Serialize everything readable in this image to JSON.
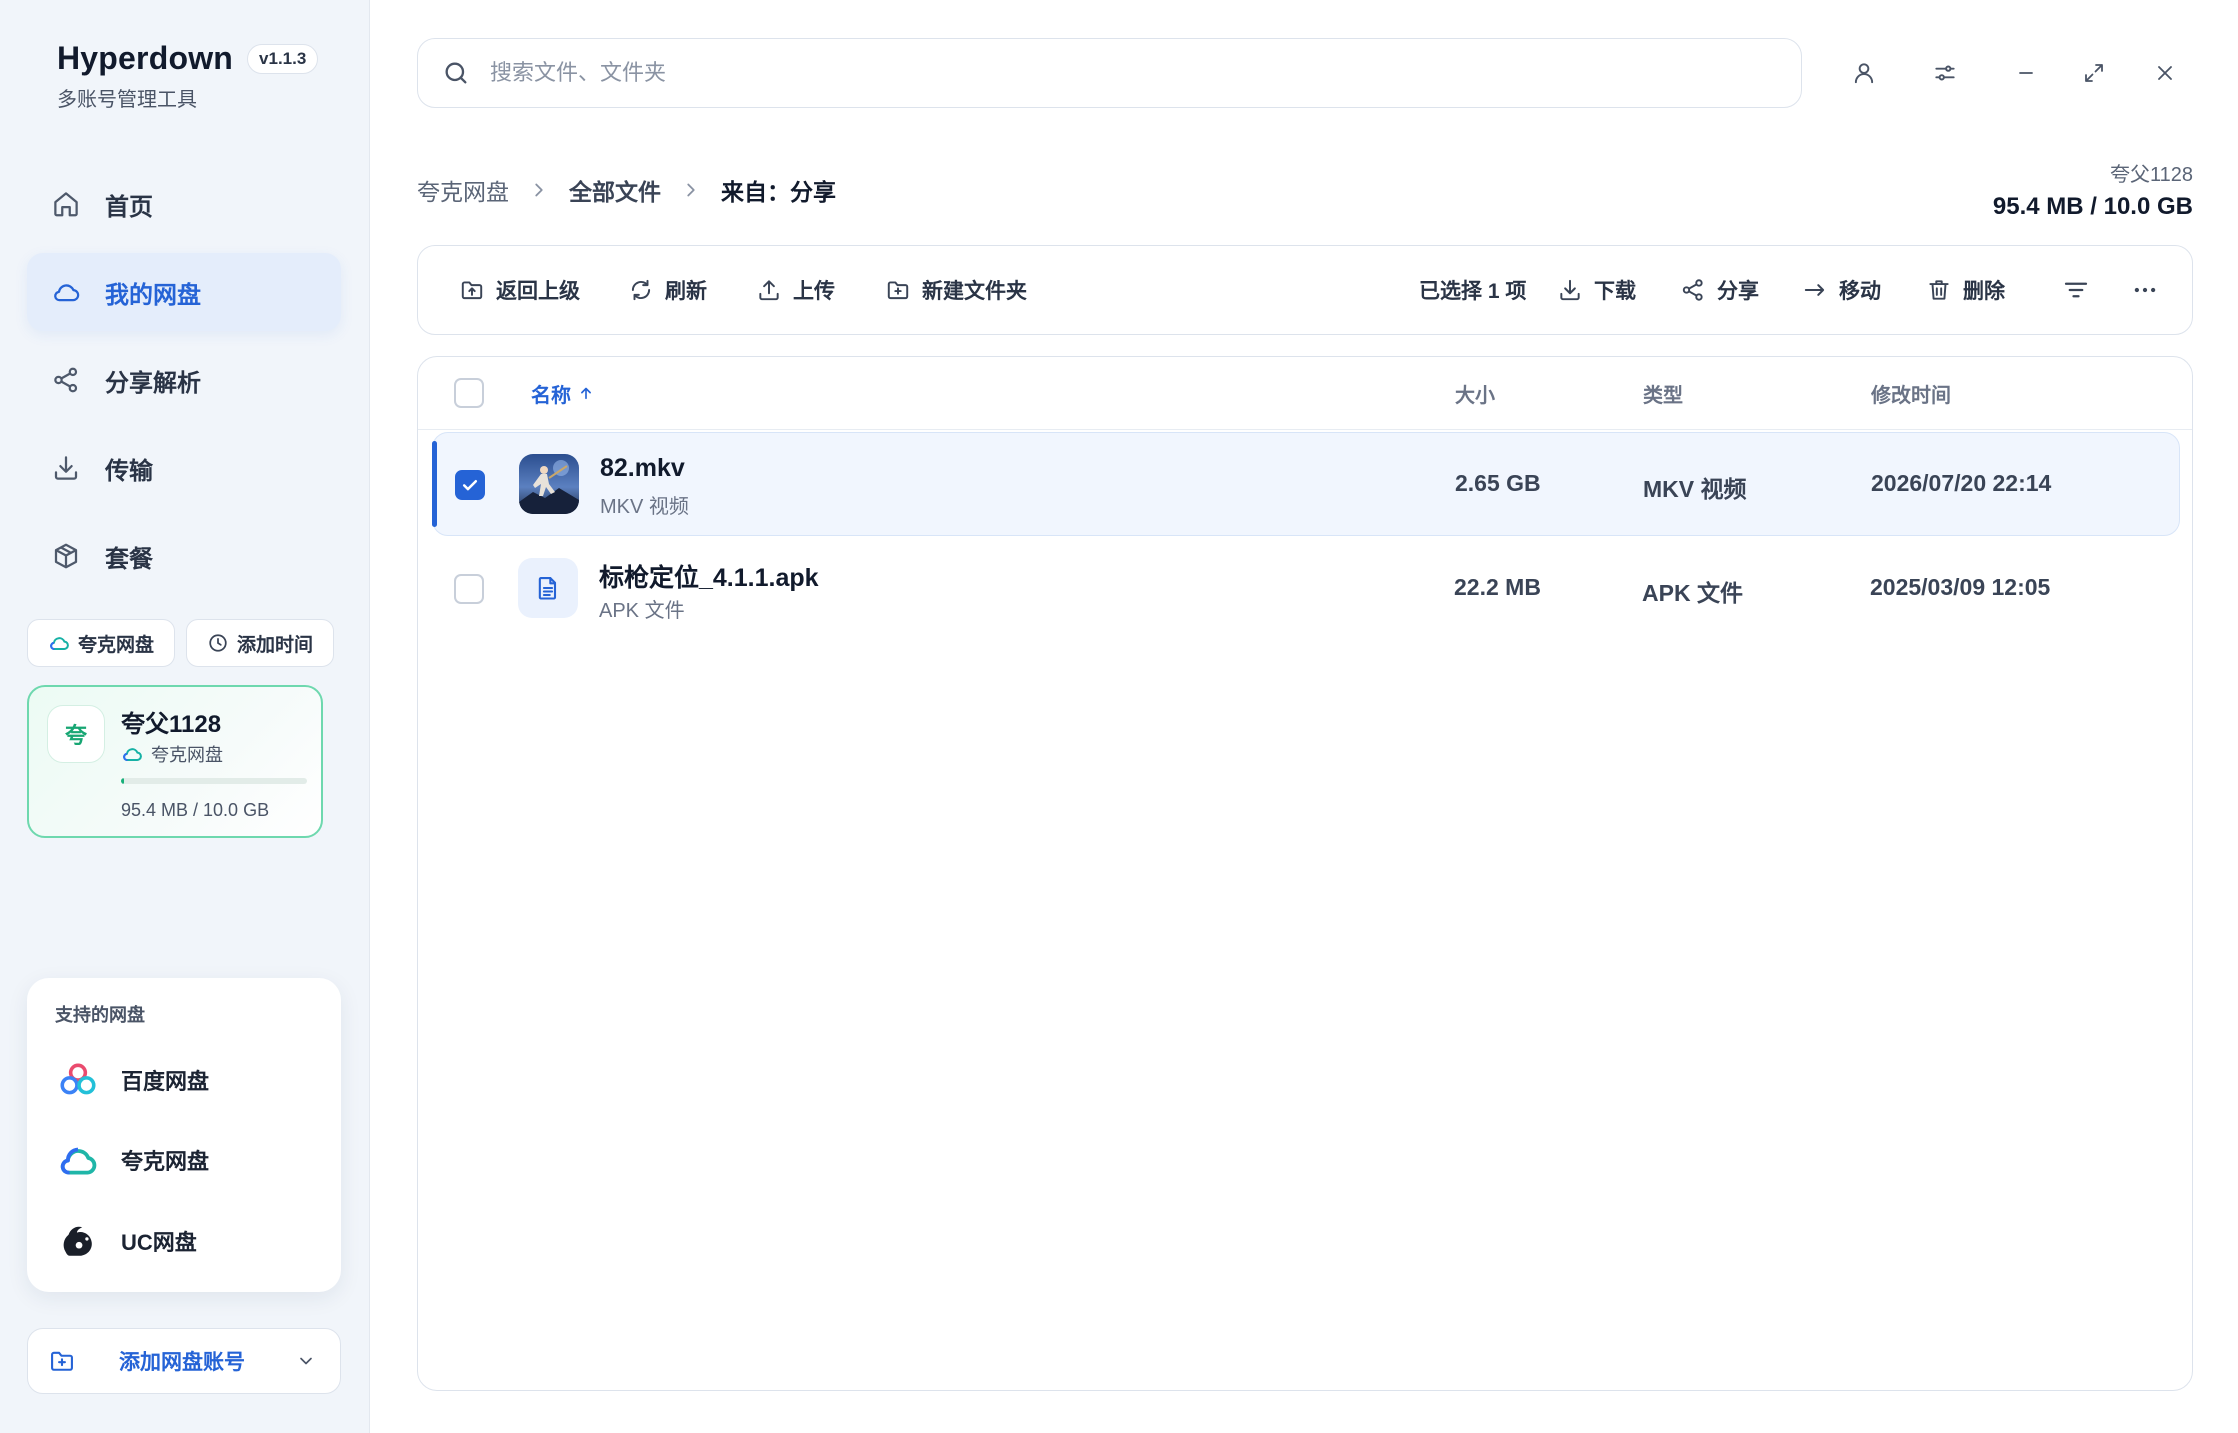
{
  "app": {
    "name": "Hyperdown",
    "version": "v1.1.3",
    "subtitle": "多账号管理工具"
  },
  "sidebar": {
    "nav": [
      {
        "label": "首页",
        "icon": "home-icon"
      },
      {
        "label": "我的网盘",
        "icon": "cloud-icon",
        "active": true
      },
      {
        "label": "分享解析",
        "icon": "share-icon"
      },
      {
        "label": "传输",
        "icon": "download-icon"
      },
      {
        "label": "套餐",
        "icon": "package-icon"
      }
    ],
    "filters": [
      {
        "label": "夸克网盘",
        "icon": "quark-cloud-icon"
      },
      {
        "label": "添加时间",
        "icon": "clock-icon"
      }
    ],
    "account": {
      "avatar_text": "夸",
      "name": "夸父1128",
      "provider": "夸克网盘",
      "usage": "95.4 MB / 10.0 GB",
      "usage_fraction": 0.0093,
      "accent_color": "#18b07a"
    },
    "supported": {
      "title": "支持的网盘",
      "items": [
        {
          "label": "百度网盘",
          "icon": "baidu-netdisk-logo"
        },
        {
          "label": "夸克网盘",
          "icon": "quark-netdisk-logo"
        },
        {
          "label": "UC网盘",
          "icon": "uc-netdisk-logo"
        }
      ]
    },
    "add_account_label": "添加网盘账号"
  },
  "search": {
    "placeholder": "搜索文件、文件夹",
    "value": ""
  },
  "breadcrumb": [
    "夸克网盘",
    "全部文件",
    "来自：分享"
  ],
  "quota": {
    "account": "夸父1128",
    "usage": "95.4 MB / 10.0 GB"
  },
  "toolbar": {
    "back": "返回上级",
    "refresh": "刷新",
    "upload": "上传",
    "new_folder": "新建文件夹",
    "selected": "已选择 1 项",
    "download": "下载",
    "share": "分享",
    "move": "移动",
    "delete": "删除"
  },
  "table": {
    "columns": {
      "name": "名称",
      "size": "大小",
      "type": "类型",
      "modified": "修改时间"
    },
    "sort": {
      "column": "name",
      "direction": "asc"
    },
    "rows": [
      {
        "name": "82.mkv",
        "subtype": "MKV 视频",
        "size": "2.65 GB",
        "type": "MKV 视频",
        "modified": "2026/07/20 22:14",
        "selected": true,
        "thumb": "video-thumbnail"
      },
      {
        "name": "标枪定位_4.1.1.apk",
        "subtype": "APK 文件",
        "size": "22.2 MB",
        "type": "APK 文件",
        "modified": "2025/03/09 12:05",
        "selected": false,
        "thumb": "document-icon"
      }
    ]
  },
  "colors": {
    "accent": "#2563d6",
    "quark_green": "#18b07a",
    "sidebar_bg": "#f1f5fa"
  }
}
